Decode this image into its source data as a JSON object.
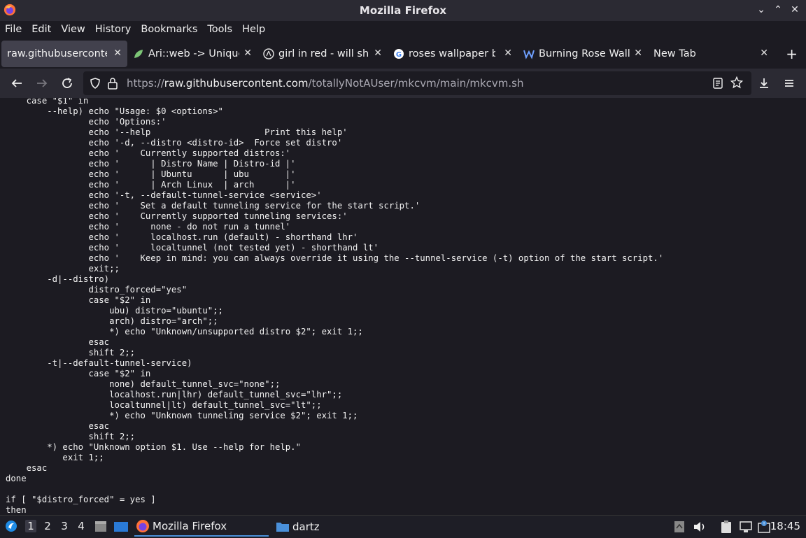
{
  "window": {
    "title": "Mozilla Firefox"
  },
  "menu": [
    "File",
    "Edit",
    "View",
    "History",
    "Bookmarks",
    "Tools",
    "Help"
  ],
  "tabs": [
    {
      "label": "raw.githubusercontent.com"
    },
    {
      "label": "Ari::web -> Unique"
    },
    {
      "label": "girl in red - will she"
    },
    {
      "label": "roses wallpaper bu"
    },
    {
      "label": "Burning Rose Wallp"
    },
    {
      "label": "New Tab"
    }
  ],
  "urlbar": {
    "prefix": "https://",
    "domain": "raw.githubusercontent.com",
    "path": "/totallyNotAUser/mkcvm/main/mkcvm.sh"
  },
  "code_lines": [
    "    case \"$1\" in",
    "        --help) echo \"Usage: $0 <options>\"",
    "                echo 'Options:'",
    "                echo '--help                      Print this help'",
    "                echo '-d, --distro <distro-id>  Force set distro'",
    "                echo '    Currently supported distros:'",
    "                echo '      | Distro Name | Distro-id |'",
    "                echo '      | Ubuntu      | ubu       |'",
    "                echo '      | Arch Linux  | arch      |'",
    "                echo '-t, --default-tunnel-service <service>'",
    "                echo '    Set a default tunneling service for the start script.'",
    "                echo '    Currently supported tunneling services:'",
    "                echo '      none - do not run a tunnel'",
    "                echo '      localhost.run (default) - shorthand lhr'",
    "                echo '      localtunnel (not tested yet) - shorthand lt'",
    "                echo '    Keep in mind: you can always override it using the --tunnel-service (-t) option of the start script.'",
    "                exit;;",
    "        -d|--distro)",
    "                distro_forced=\"yes\"",
    "                case \"$2\" in",
    "                    ubu) distro=\"ubuntu\";;",
    "                    arch) distro=\"arch\";;",
    "                    *) echo \"Unknown/unsupported distro $2\"; exit 1;;",
    "                esac",
    "                shift 2;;",
    "        -t|--default-tunnel-service)",
    "                case \"$2\" in",
    "                    none) default_tunnel_svc=\"none\";;",
    "                    localhost.run|lhr) default_tunnel_svc=\"lhr\";;",
    "                    localtunnel|lt) default_tunnel_svc=\"lt\";;",
    "                    *) echo \"Unknown tunneling service $2\"; exit 1;;",
    "                esac",
    "                shift 2;;",
    "        *) echo \"Unknown option $1. Use --help for help.\"",
    "           exit 1;;",
    "    esac",
    "done",
    "",
    "if [ \"$distro_forced\" = yes ]",
    "then"
  ],
  "taskbar": {
    "workspaces": [
      "1",
      "2",
      "3",
      "4"
    ],
    "items": [
      "Mozilla Firefox",
      "dartz"
    ],
    "clock": "18:45"
  },
  "colors": {
    "accent": "#4a90d9",
    "background": "#1c1b22",
    "toolbar": "#2b2a33"
  }
}
